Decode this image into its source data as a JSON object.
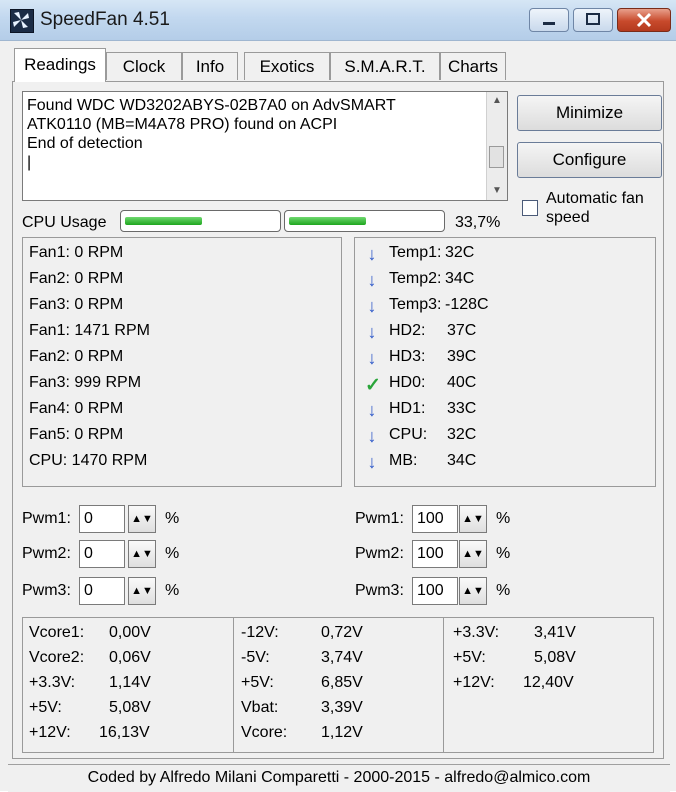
{
  "window": {
    "title": "SpeedFan 4.51",
    "icon": "fan-icon"
  },
  "tabs": [
    "Readings",
    "Clock",
    "Info",
    "Exotics",
    "S.M.A.R.T.",
    "Charts"
  ],
  "log": {
    "lines": [
      "Found WDC WD3202ABYS-02B7A0 on AdvSMART",
      "ATK0110 (MB=M4A78 PRO) found on ACPI",
      "End of detection",
      "|"
    ]
  },
  "buttons": {
    "minimize": "Minimize",
    "configure": "Configure"
  },
  "auto_fan": {
    "label": "Automatic fan speed",
    "checked": false
  },
  "cpu": {
    "label": "CPU Usage",
    "percent_text": "33,7%",
    "core_fill": [
      0.5,
      0.5
    ]
  },
  "fans": [
    "Fan1: 0 RPM",
    "Fan2: 0 RPM",
    "Fan3: 0 RPM",
    "Fan1: 1471 RPM",
    "Fan2: 0 RPM",
    "Fan3: 999 RPM",
    "Fan4: 0 RPM",
    "Fan5: 0 RPM",
    "CPU:  1470 RPM"
  ],
  "temps": [
    {
      "label": "Temp1:",
      "value": "32C",
      "icon": "arrow-down-icon"
    },
    {
      "label": "Temp2:",
      "value": "34C",
      "icon": "arrow-down-icon"
    },
    {
      "label": "Temp3:",
      "value": "-128C",
      "icon": "arrow-down-icon"
    },
    {
      "label": "HD2:",
      "value": "37C",
      "icon": "arrow-down-icon"
    },
    {
      "label": "HD3:",
      "value": "39C",
      "icon": "arrow-down-icon"
    },
    {
      "label": "HD0:",
      "value": "40C",
      "icon": "checkmark-icon"
    },
    {
      "label": "HD1:",
      "value": "33C",
      "icon": "arrow-down-icon"
    },
    {
      "label": "CPU:",
      "value": "32C",
      "icon": "arrow-down-icon"
    },
    {
      "label": "MB:",
      "value": "34C",
      "icon": "arrow-down-icon"
    }
  ],
  "pwm_left": [
    {
      "label": "Pwm1:",
      "value": "0"
    },
    {
      "label": "Pwm2:",
      "value": "0"
    },
    {
      "label": "Pwm3:",
      "value": "0"
    }
  ],
  "pwm_right": [
    {
      "label": "Pwm1:",
      "value": "100"
    },
    {
      "label": "Pwm2:",
      "value": "100"
    },
    {
      "label": "Pwm3:",
      "value": "100"
    }
  ],
  "pwm_unit": "%",
  "voltages": {
    "col1": [
      {
        "label": "Vcore1:",
        "value": "0,00V"
      },
      {
        "label": "Vcore2:",
        "value": "0,06V"
      },
      {
        "label": "+3.3V:",
        "value": "1,14V"
      },
      {
        "label": "+5V:",
        "value": "5,08V"
      },
      {
        "label": "+12V:",
        "value": "16,13V"
      }
    ],
    "col2": [
      {
        "label": "-12V:",
        "value": "0,72V"
      },
      {
        "label": "-5V:",
        "value": "3,74V"
      },
      {
        "label": "+5V:",
        "value": "6,85V"
      },
      {
        "label": "Vbat:",
        "value": "3,39V"
      },
      {
        "label": "Vcore:",
        "value": "1,12V"
      }
    ],
    "col3": [
      {
        "label": "+3.3V:",
        "value": "3,41V"
      },
      {
        "label": "+5V:",
        "value": "5,08V"
      },
      {
        "label": "+12V:",
        "value": "12,40V"
      }
    ]
  },
  "status": "Coded by Alfredo Milani Comparetti - 2000-2015 - alfredo@almico.com"
}
